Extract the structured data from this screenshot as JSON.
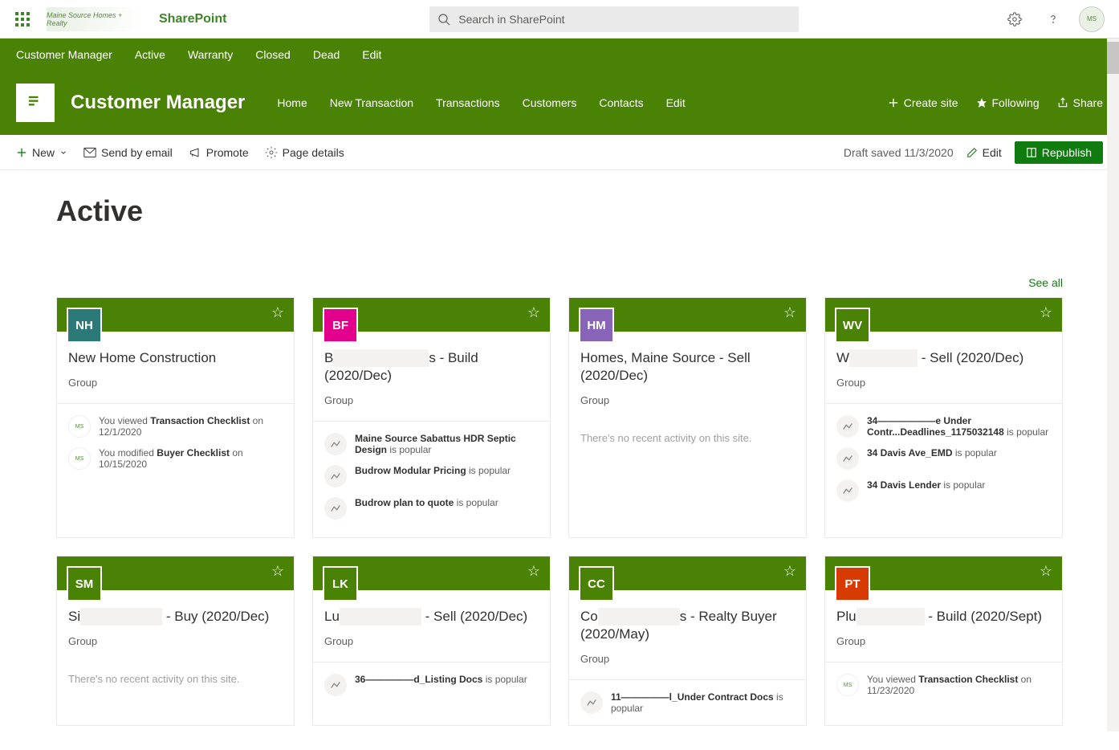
{
  "suite": {
    "app_name": "SharePoint",
    "tenant_name": "Maine Source Homes + Realty",
    "search_placeholder": "Search in SharePoint"
  },
  "hub_nav": [
    "Customer Manager",
    "Active",
    "Warranty",
    "Closed",
    "Dead",
    "Edit"
  ],
  "site": {
    "title": "Customer Manager",
    "nav": [
      "Home",
      "New Transaction",
      "Transactions",
      "Customers",
      "Contacts",
      "Edit"
    ],
    "actions": {
      "create_site": "Create site",
      "following": "Following",
      "share": "Share"
    }
  },
  "cmd": {
    "new": "New",
    "send_email": "Send by email",
    "promote": "Promote",
    "page_details": "Page details",
    "draft_saved": "Draft saved 11/3/2020",
    "edit": "Edit",
    "republish": "Republish"
  },
  "page": {
    "title": "Active",
    "see_all": "See all"
  },
  "cards": [
    {
      "badge": "NH",
      "badge_color": "#2b7a78",
      "title_pre": "New Home Construction",
      "title_redact": "",
      "title_post": "",
      "sub": "Group",
      "activity": [
        {
          "icon": "logo",
          "pre": "You viewed ",
          "bold": "Transaction Checklist",
          "post": " on 12/1/2020"
        },
        {
          "icon": "logo",
          "pre": "You modified ",
          "bold": "Buyer Checklist",
          "post": " on 10/15/2020"
        }
      ],
      "no_activity": ""
    },
    {
      "badge": "BF",
      "badge_color": "#e3008c",
      "title_pre": "B",
      "title_redact": "———————",
      "title_post": "s - Build (2020/Dec)",
      "sub": "Group",
      "activity": [
        {
          "icon": "chart",
          "pre": "",
          "bold": "Maine Source Sabattus HDR Septic Design",
          "post": " is popular"
        },
        {
          "icon": "chart",
          "pre": "",
          "bold": "Budrow Modular Pricing",
          "post": " is popular"
        },
        {
          "icon": "chart",
          "pre": "",
          "bold": "Budrow plan to quote",
          "post": " is popular"
        }
      ],
      "no_activity": ""
    },
    {
      "badge": "HM",
      "badge_color": "#8764b8",
      "title_pre": "Homes, Maine Source - Sell (2020/Dec)",
      "title_redact": "",
      "title_post": "",
      "sub": "Group",
      "activity": [],
      "no_activity": "There's no recent activity on this site."
    },
    {
      "badge": "WV",
      "badge_color": "#498205",
      "title_pre": "W",
      "title_redact": "—————",
      "title_post": " - Sell (2020/Dec)",
      "sub": "Group",
      "activity": [
        {
          "icon": "chart",
          "pre": "",
          "bold": "34——————e Under Contr...Deadlines_1175032148",
          "post": " is popular"
        },
        {
          "icon": "chart",
          "pre": "",
          "bold": "34 Davis Ave_EMD",
          "post": " is popular"
        },
        {
          "icon": "chart",
          "pre": "",
          "bold": "34 Davis Lender",
          "post": " is popular"
        }
      ],
      "no_activity": ""
    },
    {
      "badge": "SM",
      "badge_color": "#498205",
      "title_pre": "Si",
      "title_redact": "——————",
      "title_post": " - Buy (2020/Dec)",
      "sub": "Group",
      "activity": [],
      "no_activity": "There's no recent activity on this site."
    },
    {
      "badge": "LK",
      "badge_color": "#498205",
      "title_pre": "Lu",
      "title_redact": "——————",
      "title_post": " - Sell (2020/Dec)",
      "sub": "Group",
      "activity": [
        {
          "icon": "chart",
          "pre": "",
          "bold": "36—————d_Listing Docs",
          "post": " is popular"
        }
      ],
      "no_activity": ""
    },
    {
      "badge": "CC",
      "badge_color": "#498205",
      "title_pre": "Co",
      "title_redact": "——————",
      "title_post": "s - Realty Buyer (2020/May)",
      "sub": "Group",
      "activity": [
        {
          "icon": "chart",
          "pre": "",
          "bold": "11—————l_Under Contract Docs",
          "post": " is popular"
        }
      ],
      "no_activity": ""
    },
    {
      "badge": "PT",
      "badge_color": "#d83b01",
      "title_pre": "Plu",
      "title_redact": "—————",
      "title_post": " - Build (2020/Sept)",
      "sub": "Group",
      "activity": [
        {
          "icon": "logo",
          "pre": "You viewed ",
          "bold": "Transaction Checklist",
          "post": " on 11/23/2020"
        }
      ],
      "no_activity": ""
    }
  ]
}
